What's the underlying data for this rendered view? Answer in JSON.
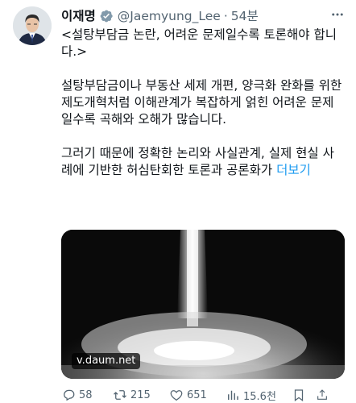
{
  "tweet": {
    "author_name": "이재명",
    "handle": "@Jaemyung_Lee",
    "separator": "·",
    "time": "54분",
    "paragraph1": "<설탕부담금 논란, 어려운 문제일수록 토론해야 합니다.>",
    "paragraph2": "설탕부담금이나 부동산 세제 개편, 양극화 완화를 위한 제도개혁처럼 이해관계가 복잡하게 얽힌 어려운 문제일수록 곡해와 오해가 많습니다.",
    "paragraph3": "그러기 때문에 정확한 논리와 사실관계, 실제 현실 사례에 기반한 허심탄회한 토론과 공론화가 ",
    "more_link": "더보기"
  },
  "card": {
    "domain": "v.daum.net"
  },
  "actions": {
    "replies": "58",
    "retweets": "215",
    "likes": "651",
    "views": "15.6천"
  },
  "colors": {
    "accent": "#1d9bf0",
    "verified_badge": "#829aab",
    "secondary_text": "#536471"
  },
  "icons": [
    "more-icon",
    "verified-badge-icon",
    "reply-icon",
    "retweet-icon",
    "like-icon",
    "views-icon",
    "bookmark-icon",
    "share-icon"
  ]
}
